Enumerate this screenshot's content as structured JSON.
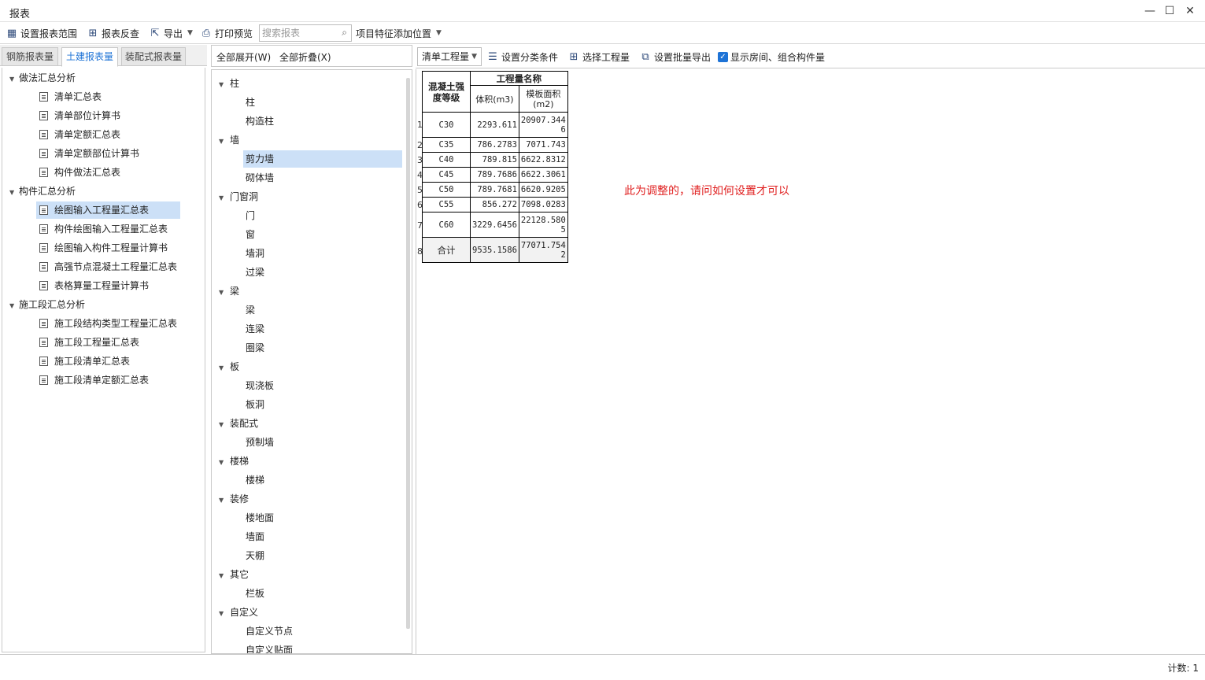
{
  "window": {
    "title": "报表"
  },
  "toolbar": {
    "set_range": "设置报表范围",
    "review": "报表反查",
    "export": "导出",
    "print_preview": "打印预览",
    "search_placeholder": "搜索报表",
    "feature_position": "项目特征添加位置"
  },
  "left_tabs": [
    "钢筋报表量",
    "土建报表量",
    "装配式报表量"
  ],
  "left_tree": {
    "groups": [
      {
        "label": "做法汇总分析",
        "items": [
          "清单汇总表",
          "清单部位计算书",
          "清单定额汇总表",
          "清单定额部位计算书",
          "构件做法汇总表"
        ]
      },
      {
        "label": "构件汇总分析",
        "items": [
          "绘图输入工程量汇总表",
          "构件绘图输入工程量汇总表",
          "绘图输入构件工程量计算书",
          "高强节点混凝土工程量汇总表",
          "表格算量工程量计算书"
        ]
      },
      {
        "label": "施工段汇总分析",
        "items": [
          "施工段结构类型工程量汇总表",
          "施工段工程量汇总表",
          "施工段清单汇总表",
          "施工段清单定额汇总表"
        ]
      }
    ],
    "selected": "绘图输入工程量汇总表"
  },
  "mid": {
    "expand_all": "全部展开(W)",
    "collapse_all": "全部折叠(X)",
    "groups": [
      {
        "label": "柱",
        "items": [
          "柱",
          "构造柱"
        ]
      },
      {
        "label": "墙",
        "items": [
          "剪力墙",
          "砌体墙"
        ]
      },
      {
        "label": "门窗洞",
        "items": [
          "门",
          "窗",
          "墙洞",
          "过梁"
        ]
      },
      {
        "label": "梁",
        "items": [
          "梁",
          "连梁",
          "圈梁"
        ]
      },
      {
        "label": "板",
        "items": [
          "现浇板",
          "板洞"
        ]
      },
      {
        "label": "装配式",
        "items": [
          "预制墙"
        ]
      },
      {
        "label": "楼梯",
        "items": [
          "楼梯"
        ]
      },
      {
        "label": "装修",
        "items": [
          "楼地面",
          "墙面",
          "天棚"
        ]
      },
      {
        "label": "其它",
        "items": [
          "栏板"
        ]
      },
      {
        "label": "自定义",
        "items": [
          "自定义节点",
          "自定义贴面"
        ]
      }
    ],
    "selected": "剪力墙"
  },
  "right_toolbar": {
    "dropdown": "清单工程量",
    "classify": "设置分类条件",
    "select_qty": "选择工程量",
    "batch_export": "设置批量导出",
    "show_rooms": "显示房间、组合构件量",
    "show_rooms_checked": true
  },
  "report": {
    "header_grade": "混凝土强度等级",
    "header_group": "工程量名称",
    "col_volume": "体积(m3)",
    "col_formwork": "模板面积(m2)",
    "rows": [
      {
        "n": "1",
        "grade": "C30",
        "volume": "2293.611",
        "formwork": "20907.3446"
      },
      {
        "n": "2",
        "grade": "C35",
        "volume": "786.2783",
        "formwork": "7071.743"
      },
      {
        "n": "3",
        "grade": "C40",
        "volume": "789.815",
        "formwork": "6622.8312"
      },
      {
        "n": "4",
        "grade": "C45",
        "volume": "789.7686",
        "formwork": "6622.3061"
      },
      {
        "n": "5",
        "grade": "C50",
        "volume": "789.7681",
        "formwork": "6620.9205"
      },
      {
        "n": "6",
        "grade": "C55",
        "volume": "856.272",
        "formwork": "7098.0283"
      },
      {
        "n": "7",
        "grade": "C60",
        "volume": "3229.6456",
        "formwork": "22128.5805"
      },
      {
        "n": "8",
        "grade": "合计",
        "volume": "9535.1586",
        "formwork": "77071.7542"
      }
    ]
  },
  "note": "此为调整的，请问如何设置才可以",
  "status": {
    "count": "计数: 1"
  }
}
